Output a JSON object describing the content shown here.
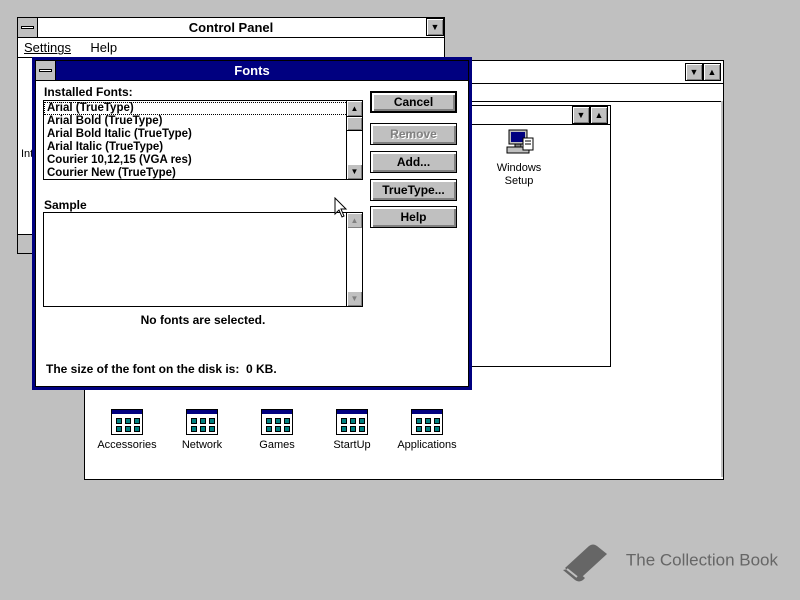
{
  "control_panel": {
    "title": "Control Panel",
    "menu": [
      "Settings",
      "Help"
    ],
    "hidden_label": "Int"
  },
  "program_manager": {
    "windows_setup_label": "Windows Setup",
    "groups": [
      {
        "label": "Accessories",
        "icon": "program-group-icon"
      },
      {
        "label": "Network",
        "icon": "program-group-icon"
      },
      {
        "label": "Games",
        "icon": "program-group-icon"
      },
      {
        "label": "StartUp",
        "icon": "program-group-icon"
      },
      {
        "label": "Applications",
        "icon": "program-group-icon"
      }
    ]
  },
  "fonts_dialog": {
    "title": "Fonts",
    "installed_label": "Installed Fonts:",
    "fonts": [
      "Arial (TrueType)",
      "Arial Bold (TrueType)",
      "Arial Bold Italic (TrueType)",
      "Arial Italic (TrueType)",
      "Courier 10,12,15 (VGA res)",
      "Courier New (TrueType)"
    ],
    "sample_label": "Sample",
    "status": "No fonts are selected.",
    "size_text": "The size of the font on the disk is:  0 KB.",
    "buttons": {
      "cancel": "Cancel",
      "remove": "Remove",
      "add": "Add...",
      "truetype": "TrueType...",
      "help": "Help"
    }
  },
  "watermark": "The Collection Book",
  "colors": {
    "desktop": "#c0c0c0",
    "active_title": "#000080",
    "window": "#ffffff"
  }
}
